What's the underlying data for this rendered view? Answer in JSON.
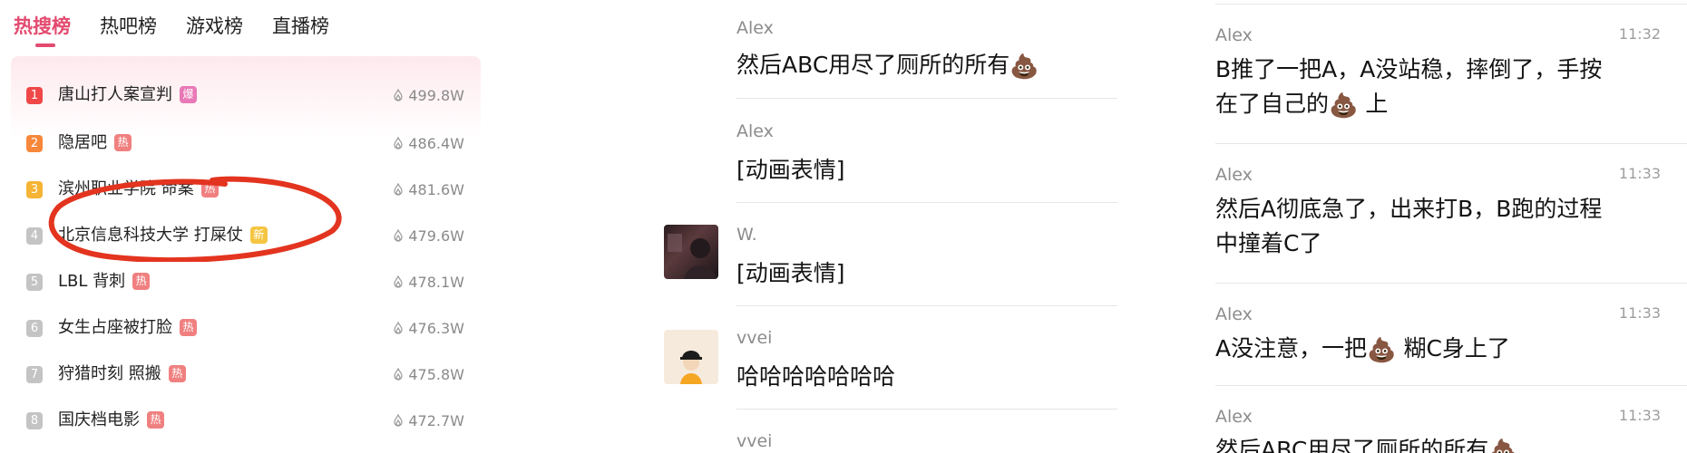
{
  "hotlist": {
    "tabs": [
      "热搜榜",
      "热吧榜",
      "游戏榜",
      "直播榜"
    ],
    "active_tab": 0,
    "items": [
      {
        "rank": "1",
        "title": "唐山打人案宣判",
        "badge": "爆",
        "heat": "499.8W",
        "rank_color": "#f04848",
        "badge_color": "#e879b6"
      },
      {
        "rank": "2",
        "title": "隐居吧",
        "badge": "热",
        "heat": "486.4W",
        "rank_color": "#f7873a",
        "badge_color": "#f08080"
      },
      {
        "rank": "3",
        "title": "滨州职业学院 命案",
        "badge": "热",
        "heat": "481.6W",
        "rank_color": "#f5b435",
        "badge_color": "#f08080"
      },
      {
        "rank": "4",
        "title": "北京信息科技大学 打屎仗",
        "badge": "新",
        "heat": "479.6W",
        "rank_color": "#c4c4c4",
        "badge_color": "#f5c542"
      },
      {
        "rank": "5",
        "title": "LBL 背刺",
        "badge": "热",
        "heat": "478.1W",
        "rank_color": "#c4c4c4",
        "badge_color": "#f08080"
      },
      {
        "rank": "6",
        "title": "女生占座被打脸",
        "badge": "热",
        "heat": "476.3W",
        "rank_color": "#c4c4c4",
        "badge_color": "#f08080"
      },
      {
        "rank": "7",
        "title": "狩猎时刻 照搬",
        "badge": "热",
        "heat": "475.8W",
        "rank_color": "#c4c4c4",
        "badge_color": "#f08080"
      },
      {
        "rank": "8",
        "title": "国庆档电影",
        "badge": "热",
        "heat": "472.7W",
        "rank_color": "#c4c4c4",
        "badge_color": "#f08080"
      }
    ]
  },
  "chat_middle": {
    "messages": [
      {
        "sender": "Alex",
        "text": "然后ABC用尽了厕所的所有",
        "emoji": "💩"
      },
      {
        "sender": "Alex",
        "text": "[动画表情]",
        "emoji": ""
      },
      {
        "sender": "W.",
        "text": "[动画表情]",
        "emoji": ""
      },
      {
        "sender": "vvei",
        "text": "哈哈哈哈哈哈哈",
        "emoji": ""
      },
      {
        "sender": "vvei",
        "text": "",
        "emoji": ""
      }
    ]
  },
  "chat_right": {
    "messages": [
      {
        "sender": "Alex",
        "time": "11:32",
        "line1": "B推了一把A，A没站稳，摔倒了，手按",
        "line2a": "在了自己的",
        "emoji": "💩",
        "line2b": "上"
      },
      {
        "sender": "Alex",
        "time": "11:33",
        "line1": "然后A彻底急了，出来打B，B跑的过程",
        "line2a": "中撞着C了",
        "emoji": "",
        "line2b": ""
      },
      {
        "sender": "Alex",
        "time": "11:33",
        "line1a": "A没注意，一把",
        "emoji": "💩",
        "line1b": "糊C身上了"
      },
      {
        "sender": "Alex",
        "time": "11:33",
        "line1": "然后ABC用尽了厕所的所有",
        "emoji": "💩"
      }
    ]
  }
}
